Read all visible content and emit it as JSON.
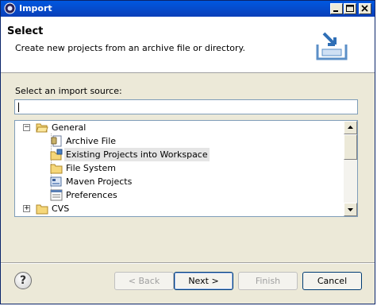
{
  "window": {
    "title": "Import"
  },
  "header": {
    "title": "Select",
    "description": "Create new projects from an archive file or directory."
  },
  "source": {
    "label": "Select an import source:",
    "filter_value": ""
  },
  "tree": {
    "items": [
      {
        "label": "General",
        "expanded": true,
        "icon": "folder-open-icon"
      },
      {
        "label": "Archive File",
        "icon": "archive-file-icon"
      },
      {
        "label": "Existing Projects into Workspace",
        "icon": "existing-projects-icon",
        "selected": true
      },
      {
        "label": "File System",
        "icon": "folder-icon"
      },
      {
        "label": "Maven Projects",
        "icon": "maven-projects-icon"
      },
      {
        "label": "Preferences",
        "icon": "preferences-icon"
      },
      {
        "label": "CVS",
        "expanded": false,
        "icon": "folder-icon"
      }
    ]
  },
  "buttons": {
    "back": "< Back",
    "next": "Next >",
    "finish": "Finish",
    "cancel": "Cancel"
  }
}
